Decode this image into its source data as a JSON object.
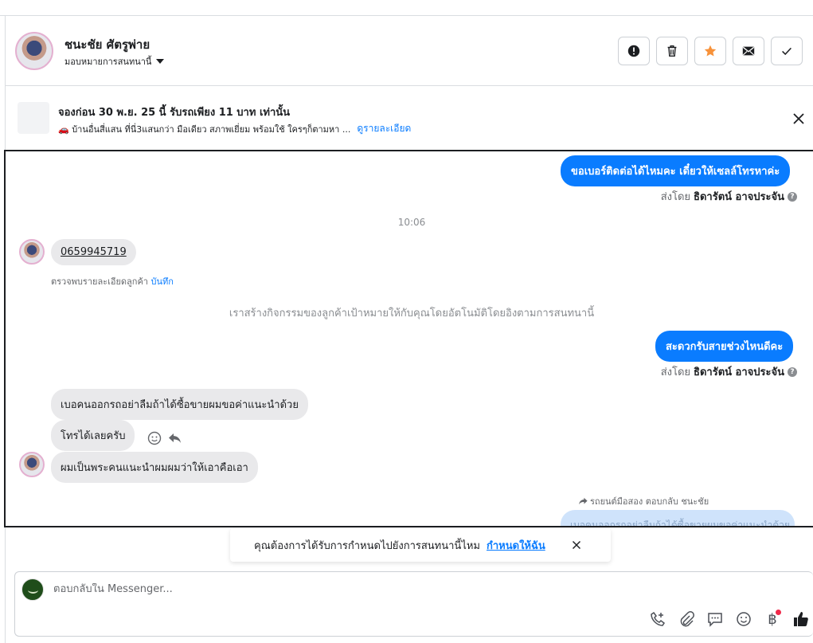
{
  "header": {
    "contact_name": "ชนะชัย ศัตรูพ่าย",
    "assign_label": "มอบหมายการสนทนานี้",
    "icons": [
      "alert-icon",
      "trash-icon",
      "star-icon",
      "mail-icon",
      "check-icon"
    ],
    "accent_star": "#f7923a"
  },
  "banner": {
    "title": "จองก่อน 30 พ.ย. 25 นี้ รับรถเพียง 11 บาท เท่านั้น",
    "description": "🚗 บ้านอื่นสี่แสน ที่นี่3แสนกว่า มือเดียว สภาพเยี่ยม พร้อมใช้ ใครๆก็ตามหา ...",
    "link": "ดูรายละเอียด"
  },
  "thread": {
    "msg_out_1": "ขอเบอร์ติดต่อได้ไหมคะ เดี๋ยวให้เซลล์โทรหาค่ะ",
    "sent_by_prefix": "ส่งโดย",
    "sender_name": "ธิดารัตน์ อาจประจัน",
    "timestamp": "10:06",
    "msg_in_phone": "0659945719",
    "detect_text": "ตรวจพบรายละเอียดลูกค้า",
    "detect_link": "บันทึก",
    "system_msg": "เราสร้างกิจกรรมของลูกค้าเป้าหมายให้กับคุณโดยอัตโนมัติโดยอิงตามการสนทนานี้",
    "msg_out_2": "สะดวกรับสายช่วงไหนดีคะ",
    "msg_in_2": "เบอคนออกรถอย่าลืมถ้าได้ซื้อขายผมขอค่าแนะนำด้วย",
    "msg_in_3": "โทรได้เลยครับ",
    "msg_in_4": "ผมเป็นพระคนแนะนำผมผมว่าให้เอาคือเอา",
    "replied_label": "รถยนต์มือสอง ตอบกลับ ชนะชัย",
    "quoted_text": "เบอคนออกรถอย่าลืมถ้าได้ซื้อขายผมขอค่าแนะนำด้วย",
    "accent": "#0a7cff"
  },
  "prompt": {
    "text": "คุณต้องการได้รับการกำหนดไปยังการสนทนานี้ไหม",
    "link": "กำหนดให้ฉัน"
  },
  "composer": {
    "placeholder": "ตอบกลับใน Messenger...",
    "baht_symbol": "฿"
  }
}
